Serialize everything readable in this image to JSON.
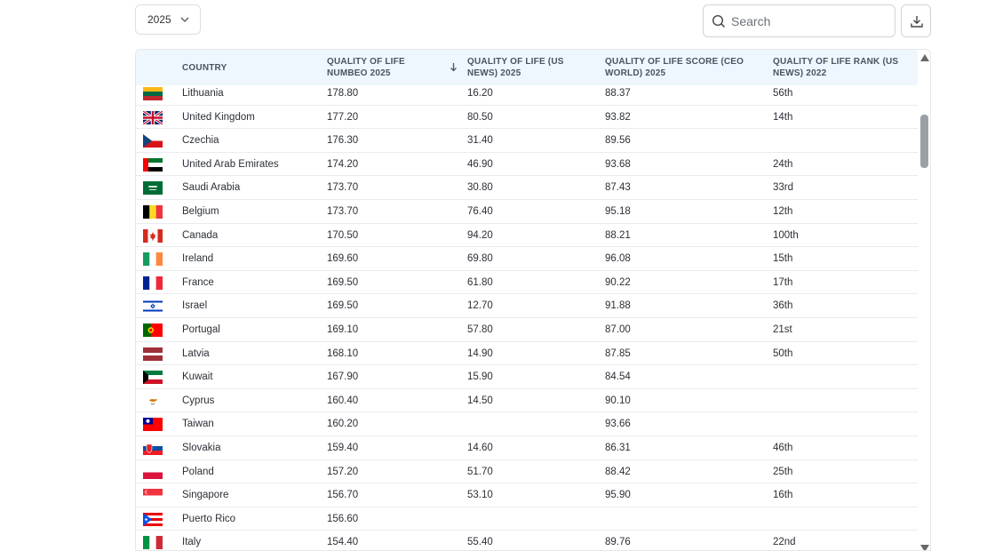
{
  "toolbar": {
    "year_value": "2025",
    "search_placeholder": "Search"
  },
  "table": {
    "headers": [
      {
        "line1": "COUNTRY",
        "line2": ""
      },
      {
        "line1": "QUALITY OF LIFE",
        "line2": "NUMBEO 2025"
      },
      {
        "line1": "QUALITY OF LIFE (US",
        "line2": "NEWS) 2025"
      },
      {
        "line1": "QUALITY OF LIFE SCORE (CEO",
        "line2": "WORLD) 2025"
      },
      {
        "line1": "QUALITY OF LIFE RANK (US",
        "line2": "NEWS) 2022"
      }
    ],
    "sort": {
      "column": "QUALITY OF LIFE NUMBEO 2025",
      "direction": "descending"
    },
    "rows": [
      {
        "country": "Lithuania",
        "flag": "lithuania-flag",
        "numbeo": "178.80",
        "usnews": "16.20",
        "ceo": "88.37",
        "rank": "56th"
      },
      {
        "country": "United Kingdom",
        "flag": "united-kingdom-flag",
        "numbeo": "177.20",
        "usnews": "80.50",
        "ceo": "93.82",
        "rank": "14th"
      },
      {
        "country": "Czechia",
        "flag": "czechia-flag",
        "numbeo": "176.30",
        "usnews": "31.40",
        "ceo": "89.56",
        "rank": ""
      },
      {
        "country": "United Arab Emirates",
        "flag": "uae-flag",
        "numbeo": "174.20",
        "usnews": "46.90",
        "ceo": "93.68",
        "rank": "24th"
      },
      {
        "country": "Saudi Arabia",
        "flag": "saudi-arabia-flag",
        "numbeo": "173.70",
        "usnews": "30.80",
        "ceo": "87.43",
        "rank": "33rd"
      },
      {
        "country": "Belgium",
        "flag": "belgium-flag",
        "numbeo": "173.70",
        "usnews": "76.40",
        "ceo": "95.18",
        "rank": "12th"
      },
      {
        "country": "Canada",
        "flag": "canada-flag",
        "numbeo": "170.50",
        "usnews": "94.20",
        "ceo": "88.21",
        "rank": "100th"
      },
      {
        "country": "Ireland",
        "flag": "ireland-flag",
        "numbeo": "169.60",
        "usnews": "69.80",
        "ceo": "96.08",
        "rank": "15th"
      },
      {
        "country": "France",
        "flag": "france-flag",
        "numbeo": "169.50",
        "usnews": "61.80",
        "ceo": "90.22",
        "rank": "17th"
      },
      {
        "country": "Israel",
        "flag": "israel-flag",
        "numbeo": "169.50",
        "usnews": "12.70",
        "ceo": "91.88",
        "rank": "36th"
      },
      {
        "country": "Portugal",
        "flag": "portugal-flag",
        "numbeo": "169.10",
        "usnews": "57.80",
        "ceo": "87.00",
        "rank": "21st"
      },
      {
        "country": "Latvia",
        "flag": "latvia-flag",
        "numbeo": "168.10",
        "usnews": "14.90",
        "ceo": "87.85",
        "rank": "50th"
      },
      {
        "country": "Kuwait",
        "flag": "kuwait-flag",
        "numbeo": "167.90",
        "usnews": "15.90",
        "ceo": "84.54",
        "rank": ""
      },
      {
        "country": "Cyprus",
        "flag": "cyprus-flag",
        "numbeo": "160.40",
        "usnews": "14.50",
        "ceo": "90.10",
        "rank": ""
      },
      {
        "country": "Taiwan",
        "flag": "taiwan-flag",
        "numbeo": "160.20",
        "usnews": "",
        "ceo": "93.66",
        "rank": ""
      },
      {
        "country": "Slovakia",
        "flag": "slovakia-flag",
        "numbeo": "159.40",
        "usnews": "14.60",
        "ceo": "86.31",
        "rank": "46th"
      },
      {
        "country": "Poland",
        "flag": "poland-flag",
        "numbeo": "157.20",
        "usnews": "51.70",
        "ceo": "88.42",
        "rank": "25th"
      },
      {
        "country": "Singapore",
        "flag": "singapore-flag",
        "numbeo": "156.70",
        "usnews": "53.10",
        "ceo": "95.90",
        "rank": "16th"
      },
      {
        "country": "Puerto Rico",
        "flag": "puerto-rico-flag",
        "numbeo": "156.60",
        "usnews": "",
        "ceo": "",
        "rank": ""
      },
      {
        "country": "Italy",
        "flag": "italy-flag",
        "numbeo": "154.40",
        "usnews": "55.40",
        "ceo": "89.76",
        "rank": "22nd"
      }
    ]
  },
  "colors": {
    "header_bg": "#eef7fd",
    "row_divider": "#e9ecef",
    "border": "#dcdfe4"
  }
}
